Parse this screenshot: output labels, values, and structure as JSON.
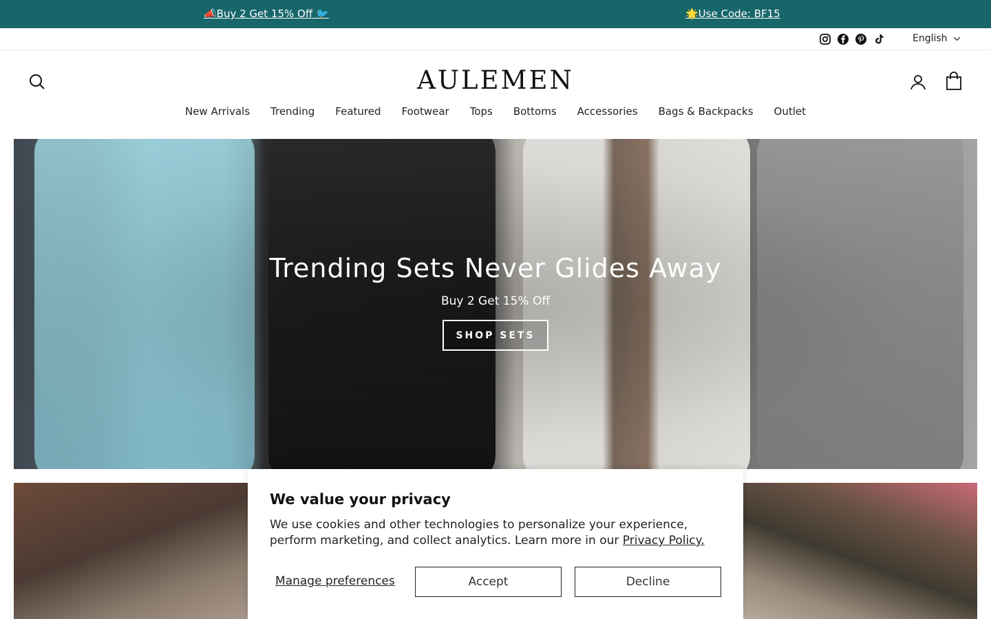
{
  "announcement": {
    "left": "📣Buy 2 Get 15% Off 🐦",
    "right": "🌟Use Code: BF15"
  },
  "utility": {
    "social_icons": [
      "instagram-icon",
      "facebook-icon",
      "pinterest-icon",
      "tiktok-icon"
    ],
    "language": "English"
  },
  "header": {
    "logo": "AULEMEN",
    "nav": [
      "New Arrivals",
      "Trending",
      "Featured",
      "Footwear",
      "Tops",
      "Bottoms",
      "Accessories",
      "Bags & Backpacks",
      "Outlet"
    ]
  },
  "hero": {
    "title": "Trending Sets Never Glides Away",
    "subtitle": "Buy 2 Get 15% Off",
    "cta": "SHOP SETS"
  },
  "cookie": {
    "title": "We value your privacy",
    "text": "We use cookies and other technologies to personalize your experience, perform marketing, and collect analytics. Learn more in our ",
    "policy_link": "Privacy Policy.",
    "manage": "Manage preferences",
    "accept": "Accept",
    "decline": "Decline"
  },
  "colors": {
    "announcement_bg": "#17666a",
    "text": "#111111"
  }
}
